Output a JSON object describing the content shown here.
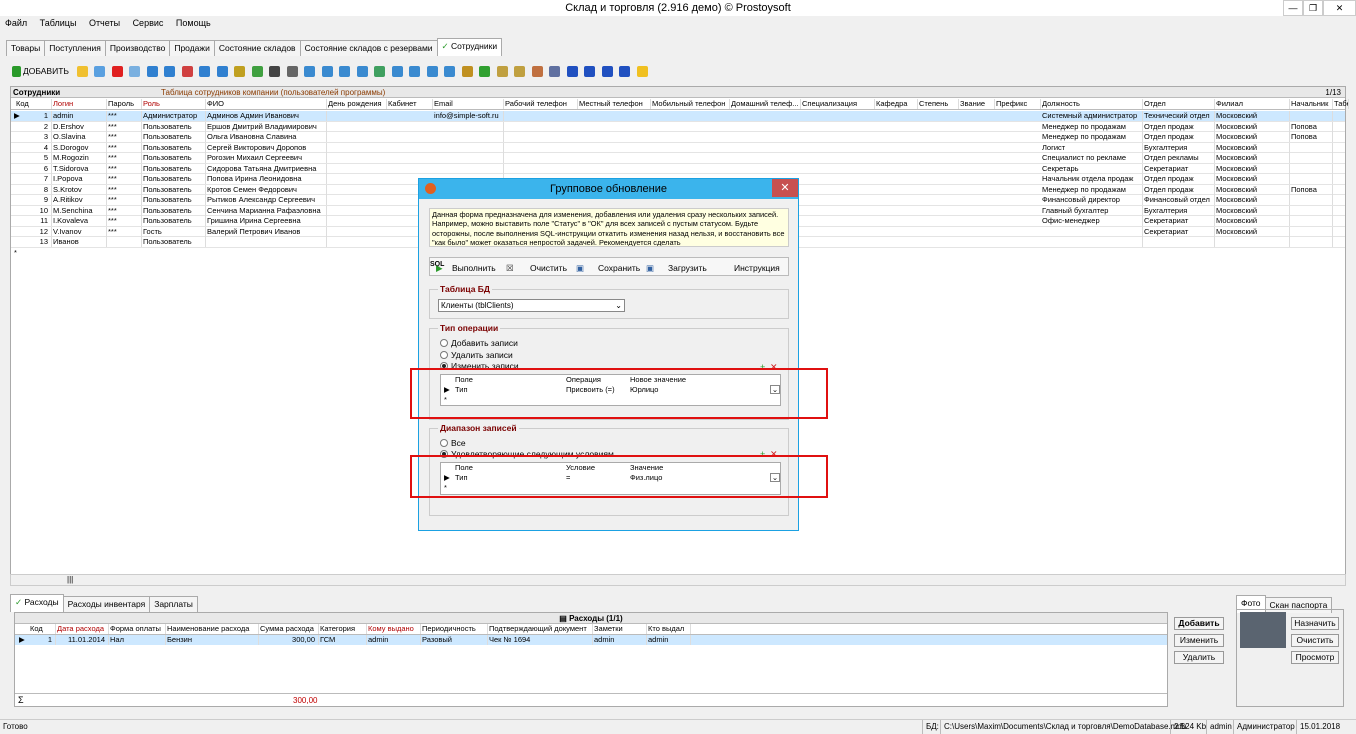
{
  "window": {
    "title": "Склад и торговля (2.916 демо) © Prostoysoft"
  },
  "menu": [
    "Файл",
    "Таблицы",
    "Отчеты",
    "Сервис",
    "Помощь"
  ],
  "tabs": [
    "Товары",
    "Поступления",
    "Производство",
    "Продажи",
    "Состояние складов",
    "Состояние складов с резервами",
    "Сотрудники"
  ],
  "toolbar": {
    "add_label": "ДОБАВИТЬ"
  },
  "panel": {
    "title": "Сотрудники",
    "subtitle": "Таблица сотрудников компании (пользователей программы)",
    "counter": "1/13"
  },
  "columns": [
    "Код",
    "Логин",
    "Пароль",
    "Роль",
    "ФИО",
    "День рождения",
    "Кабинет",
    "Email",
    "Рабочий телефон",
    "Местный телефон",
    "Мобильный телефон",
    "Домашний телеф...",
    "Специализация",
    "Кафедра",
    "Степень",
    "Звание",
    "Префикс",
    "Должность",
    "Отдел",
    "Филиал",
    "Начальник",
    "Табе"
  ],
  "employees": [
    {
      "id": "1",
      "login": "admin",
      "pwd": "***",
      "role": "Администратор",
      "fio": "Админов Админ Иванович",
      "email": "info@simple-soft.ru",
      "pos": "Системный администратор",
      "dept": "Технический отдел",
      "branch": "Московский",
      "boss": ""
    },
    {
      "id": "2",
      "login": "D.Ershov",
      "pwd": "***",
      "role": "Пользователь",
      "fio": "Ершов Дмитрий Владимирович",
      "email": "",
      "pos": "Менеджер по продажам",
      "dept": "Отдел продаж",
      "branch": "Московский",
      "boss": "Попова"
    },
    {
      "id": "3",
      "login": "O.Slavina",
      "pwd": "***",
      "role": "Пользователь",
      "fio": "Ольга Ивановна Славина",
      "email": "",
      "pos": "Менеджер по продажам",
      "dept": "Отдел продаж",
      "branch": "Московский",
      "boss": "Попова"
    },
    {
      "id": "4",
      "login": "S.Dorogov",
      "pwd": "***",
      "role": "Пользователь",
      "fio": "Сергей Викторович Доропов",
      "email": "",
      "pos": "Логист",
      "dept": "Бухгалтерия",
      "branch": "Московский",
      "boss": ""
    },
    {
      "id": "5",
      "login": "M.Rogozin",
      "pwd": "***",
      "role": "Пользователь",
      "fio": "Рогозин Михаил Сергеевич",
      "email": "",
      "pos": "Специалист по рекламе",
      "dept": "Отдел рекламы",
      "branch": "Московский",
      "boss": ""
    },
    {
      "id": "6",
      "login": "T.Sidorova",
      "pwd": "***",
      "role": "Пользователь",
      "fio": "Сидорова Татьяна Дмитриевна",
      "email": "",
      "pos": "Секретарь",
      "dept": "Секретариат",
      "branch": "Московский",
      "boss": ""
    },
    {
      "id": "7",
      "login": "I.Popova",
      "pwd": "***",
      "role": "Пользователь",
      "fio": "Попова Ирина Леонидовна",
      "email": "",
      "pos": "Начальник отдела продаж",
      "dept": "Отдел продаж",
      "branch": "Московский",
      "boss": ""
    },
    {
      "id": "8",
      "login": "S.Krotov",
      "pwd": "***",
      "role": "Пользователь",
      "fio": "Кротов Семен Федорович",
      "email": "",
      "pos": "Менеджер по продажам",
      "dept": "Отдел продаж",
      "branch": "Московский",
      "boss": "Попова"
    },
    {
      "id": "9",
      "login": "A.Ritikov",
      "pwd": "***",
      "role": "Пользователь",
      "fio": "Рытиков Александр Сергеевич",
      "email": "",
      "pos": "Финансовый директор",
      "dept": "Финансовый отдел",
      "branch": "Московский",
      "boss": ""
    },
    {
      "id": "10",
      "login": "M.Senchina",
      "pwd": "***",
      "role": "Пользователь",
      "fio": "Сенчина Марианна Рафаэловна",
      "email": "",
      "pos": "Главный бухгалтер",
      "dept": "Бухгалтерия",
      "branch": "Московский",
      "boss": ""
    },
    {
      "id": "11",
      "login": "I.Kovaleva",
      "pwd": "***",
      "role": "Пользователь",
      "fio": "Гришина Ирина Сергеевна",
      "email": "",
      "pos": "Офис-менеджер",
      "dept": "Секретариат",
      "branch": "Московский",
      "boss": ""
    },
    {
      "id": "12",
      "login": "V.Ivanov",
      "pwd": "***",
      "role": "Гость",
      "fio": "Валерий Петрович Иванов",
      "email": "",
      "pos": "",
      "dept": "Секретариат",
      "branch": "Московский",
      "boss": ""
    },
    {
      "id": "13",
      "login": "Иванов",
      "pwd": "",
      "role": "Пользователь",
      "fio": "",
      "email": "",
      "pos": "",
      "dept": "",
      "branch": "",
      "boss": ""
    }
  ],
  "dialog": {
    "title": "Групповое обновление",
    "note": "Данная форма  предназначена для изменения, добавления или удаления сразу нескольких записей. Например, можно выставить поле \"Статус\" в \"ОК\" для всех записей с пустым статусом. Будьте осторожны, после выполнения SQL-инструкции откатить изменения назад нельзя, и восстановить все \"как было\" может оказаться непростой задачей. Рекомендуется сделать",
    "run": "Выполнить",
    "clear": "Очистить",
    "save": "Сохранить",
    "load": "Загрузить",
    "sql": "SQL",
    "instr": "Инструкция",
    "db_group": "Таблица БД",
    "db_value": "Клиенты (tblClients)",
    "op_group": "Тип операции",
    "op_add": "Добавить записи",
    "op_del": "Удалить записи",
    "op_edit": "Изменить записи",
    "op_cols": [
      "Поле",
      "Операция",
      "Новое значение"
    ],
    "op_row": [
      "Тип",
      "Присвоить (=)",
      "Юрлицо"
    ],
    "range_group": "Диапазон записей",
    "range_all": "Все",
    "range_cond": "Удовлетворяющие следующим условиям",
    "cond_cols": [
      "Поле",
      "Условие",
      "Значение"
    ],
    "cond_row": [
      "Тип",
      "=",
      "Физ.лицо"
    ]
  },
  "bottom_tabs": [
    "Расходы",
    "Расходы инвентаря",
    "Зарплаты"
  ],
  "expenses": {
    "title": "Расходы (1/1)",
    "cols": [
      "Код",
      "Дата расхода",
      "Форма оплаты",
      "Наименование расхода",
      "Сумма расхода",
      "Категория",
      "Кому выдано",
      "Периодичность",
      "Подтверждающий документ",
      "Заметки",
      "Кто выдал"
    ],
    "row": [
      "1",
      "11.01.2014",
      "Нал",
      "Бензин",
      "300,00",
      "ГСМ",
      "admin",
      "Разовый",
      "Чек № 1694",
      "admin",
      "admin"
    ],
    "total": "300,00",
    "sigma": "Σ"
  },
  "exp_buttons": {
    "add": "Добавить",
    "edit": "Изменить",
    "del": "Удалить"
  },
  "photo_tabs": [
    "Фото",
    "Скан паспорта"
  ],
  "photo_buttons": {
    "assign": "Назначить",
    "clear": "Очистить",
    "view": "Просмотр"
  },
  "status": {
    "ready": "Готово",
    "db_label": "БД:",
    "db_path": "C:\\Users\\Maxim\\Documents\\Склад и торговля\\DemoDatabase.mdb",
    "size": "2 524 Kb",
    "user": "admin",
    "role": "Администратор",
    "date": "15.01.2018"
  }
}
